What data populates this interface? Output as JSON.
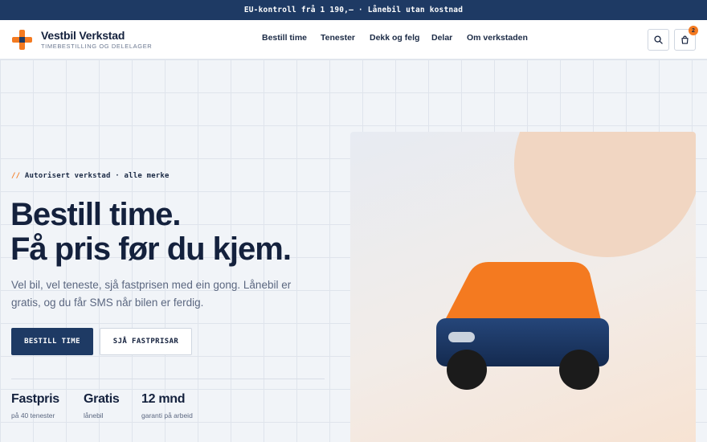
{
  "announcement": "EU-kontroll frå 1 190,– · Lånebil utan kostnad",
  "brand": {
    "name": "Vestbil Verkstad",
    "tagline": "TIMEBESTILLING OG DELELAGER"
  },
  "nav": [
    {
      "label": "Bestill time"
    },
    {
      "label": "Tenester"
    },
    {
      "label": "Dekk og felg"
    },
    {
      "label": "Delar"
    },
    {
      "label": "Om verkstaden"
    }
  ],
  "header_actions": {
    "search_icon": "search-icon",
    "cart_icon": "shopping-bag-icon",
    "cart_count": "2"
  },
  "hero": {
    "eyebrow_prefix": "//",
    "eyebrow": "Autorisert verkstad · alle merke",
    "title_line1": "Bestill time.",
    "title_line2": "Få pris før du kjem.",
    "lede": "Vel bil, vel teneste, sjå fastprisen med ein gong. Lånebil er gratis, og du får SMS når bilen er ferdig.",
    "cta_primary": "BESTILL TIME",
    "cta_secondary": "SJÅ FASTPRISAR"
  },
  "stats": [
    {
      "value": "Fastpris",
      "label": "på 40 tenester"
    },
    {
      "value": "Gratis",
      "label": "lånebil"
    },
    {
      "value": "12 mnd",
      "label": "garanti på arbeid"
    }
  ],
  "colors": {
    "navy": "#1e3a64",
    "accent": "#f47a20",
    "background": "#f1f4f8",
    "peach": "#f1d6c2"
  },
  "illustration": {
    "icon": "car-icon"
  }
}
